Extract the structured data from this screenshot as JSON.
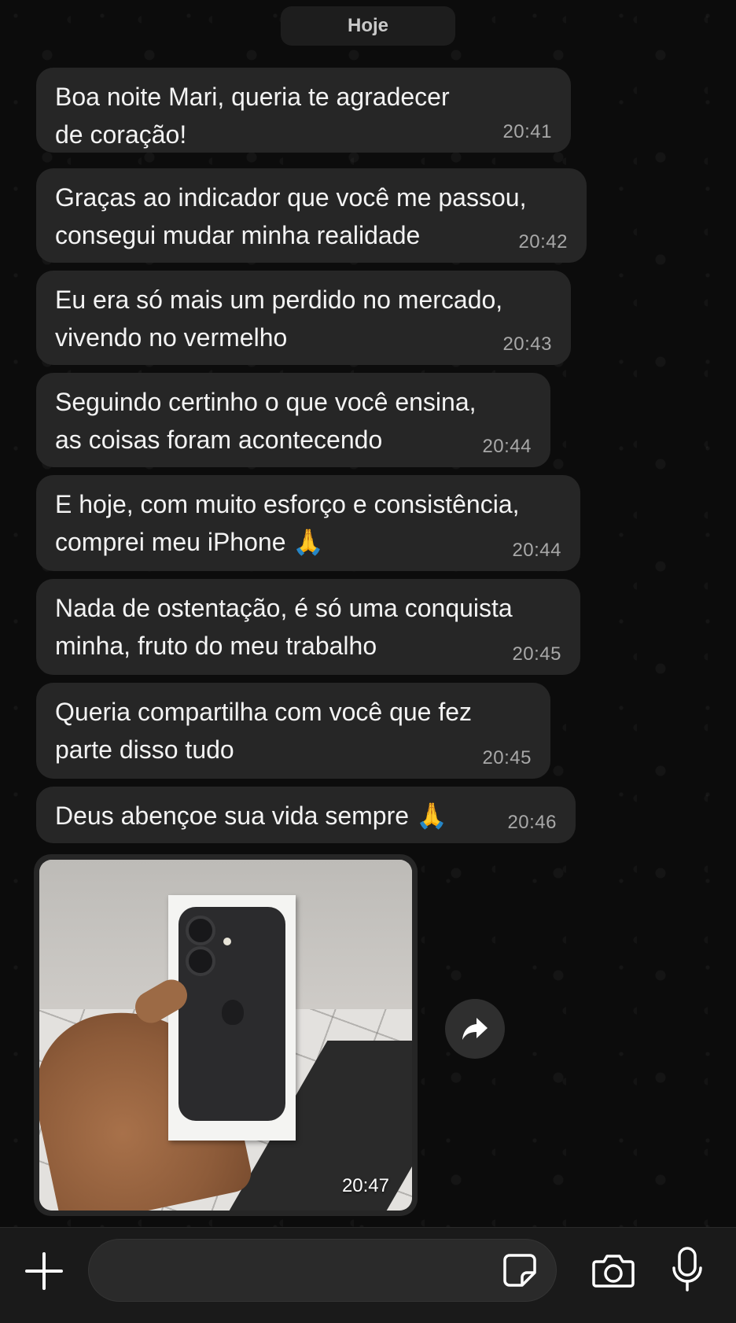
{
  "chat": {
    "date_label": "Hoje",
    "messages": [
      {
        "text": "Boa noite Mari, queria te agradecer\nde coração!",
        "time": "20:41"
      },
      {
        "text": "Graças ao indicador que você me passou,\nconsegui mudar minha realidade",
        "time": "20:42"
      },
      {
        "text": "Eu era só mais um perdido no mercado,\nvivendo no vermelho",
        "time": "20:43"
      },
      {
        "text": "Seguindo certinho o que você ensina,\nas coisas foram acontecendo",
        "time": "20:44"
      },
      {
        "text": "E hoje, com muito esforço e consistência,\ncomprei meu iPhone 🙏",
        "time": "20:44"
      },
      {
        "text": "Nada de ostentação, é só uma conquista\nminha, fruto do meu trabalho",
        "time": "20:45"
      },
      {
        "text": "Queria compartilha com você que fez\nparte disso tudo",
        "time": "20:45"
      },
      {
        "text": "Deus abençoe sua vida sempre 🙏",
        "time": "20:46"
      }
    ],
    "image_message": {
      "time": "20:47",
      "icon": "forward-icon"
    }
  },
  "composer": {
    "input_value": "",
    "input_placeholder": "",
    "icons": [
      "plus-icon",
      "sticker-icon",
      "camera-icon",
      "microphone-icon"
    ]
  },
  "colors": {
    "background": "#0c0c0c",
    "bubble": "#262626",
    "timestamp": "#a8a8a8",
    "bottom_bar": "#1a1a1a"
  }
}
